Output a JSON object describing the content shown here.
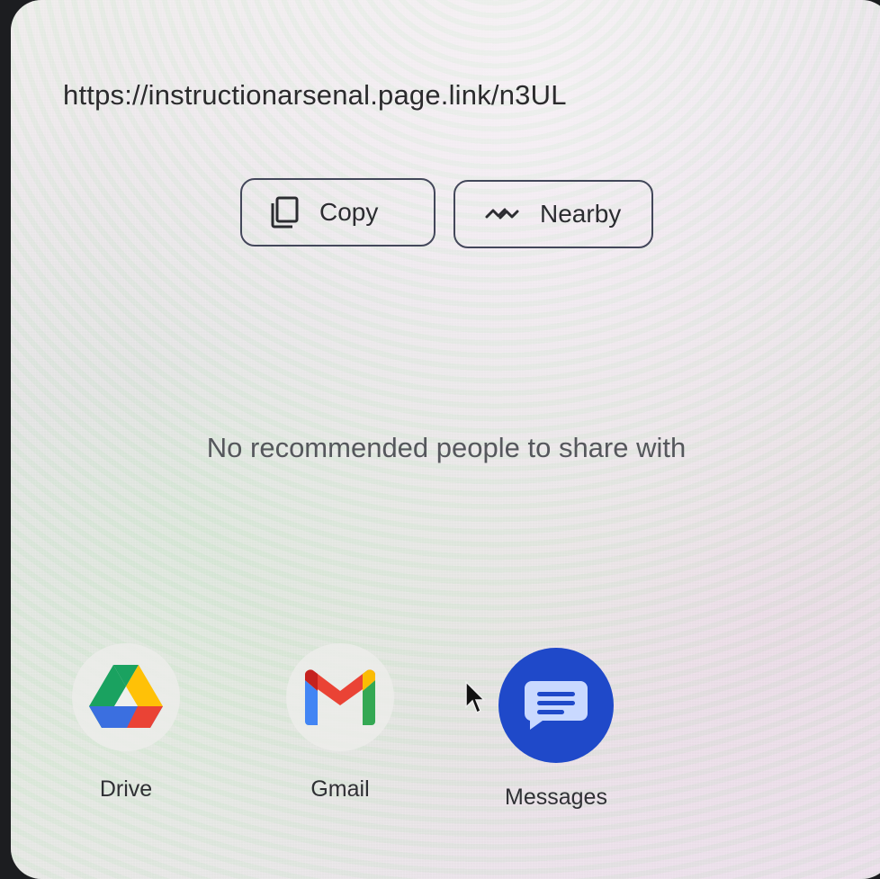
{
  "share_sheet": {
    "url": "https://instructionarsenal.page.link/n3UL",
    "actions": {
      "copy_label": "Copy",
      "copy_icon": "copy-icon",
      "nearby_label": "Nearby",
      "nearby_icon": "nearby-share-icon"
    },
    "empty_people_message": "No recommended people to share with",
    "apps": [
      {
        "label": "Drive",
        "icon": "google-drive-icon"
      },
      {
        "label": "Gmail",
        "icon": "gmail-icon"
      },
      {
        "label": "Messages",
        "icon": "messages-icon"
      }
    ]
  },
  "colors": {
    "chip_border": "#43475a",
    "messages_blue": "#1f49c9",
    "text_primary": "#2b2b2d",
    "text_secondary": "#55575c"
  }
}
